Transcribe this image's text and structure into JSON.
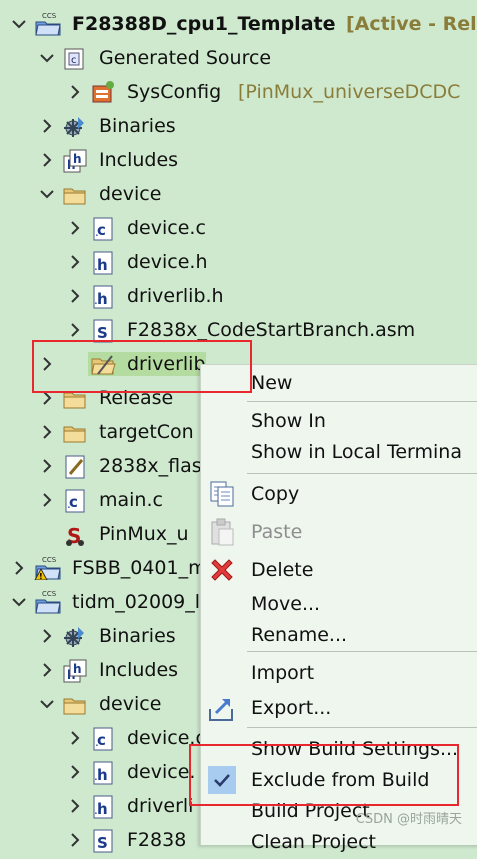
{
  "tree": {
    "rows": [
      {
        "label": "F28388D_cpu1_Template",
        "decoration": "[Active - Rele",
        "icon": "ccs-project-icon",
        "expanded": true,
        "bold": true
      },
      {
        "label": "Generated Source",
        "icon": "folder-source-icon",
        "expanded": true
      },
      {
        "label": "SysConfig",
        "decoration": "[PinMux_universeDCDC",
        "icon": "sysconfig-icon",
        "expanded": false
      },
      {
        "label": "Binaries",
        "icon": "binaries-icon",
        "expanded": false
      },
      {
        "label": "Includes",
        "icon": "includes-icon",
        "expanded": false
      },
      {
        "label": "device",
        "icon": "folder-icon",
        "expanded": true
      },
      {
        "label": "device.c",
        "icon": "c-file-icon",
        "expanded": false
      },
      {
        "label": "device.h",
        "icon": "h-file-icon",
        "expanded": false
      },
      {
        "label": "driverlib.h",
        "icon": "h-file-icon",
        "expanded": false
      },
      {
        "label": "F2838x_CodeStartBranch.asm",
        "icon": "asm-file-icon",
        "expanded": false
      },
      {
        "label": "driverlib",
        "icon": "folder-excluded-icon",
        "expanded": false,
        "selected": true
      },
      {
        "label": "Release",
        "icon": "folder-icon",
        "expanded": false
      },
      {
        "label": "targetCon",
        "icon": "folder-icon",
        "expanded": false
      },
      {
        "label": "2838x_flas",
        "icon": "linker-file-icon",
        "expanded": false
      },
      {
        "label": "main.c",
        "icon": "c-file-icon",
        "expanded": false
      },
      {
        "label": "PinMux_u",
        "icon": "syscfg-file-icon"
      },
      {
        "label": "FSBB_0401_m",
        "icon": "ccs-project-warning-icon",
        "expanded": false
      },
      {
        "label": "tidm_02009_l",
        "icon": "ccs-project-icon",
        "expanded": true
      },
      {
        "label": "Binaries",
        "icon": "binaries-icon",
        "expanded": false
      },
      {
        "label": "Includes",
        "icon": "includes-icon",
        "expanded": false
      },
      {
        "label": "device",
        "icon": "folder-icon",
        "expanded": true
      },
      {
        "label": "device.c",
        "icon": "c-file-icon",
        "expanded": false
      },
      {
        "label": "device.",
        "icon": "h-file-icon",
        "expanded": false
      },
      {
        "label": "driverli",
        "icon": "h-file-icon",
        "expanded": false
      },
      {
        "label": "F2838",
        "icon": "asm-file-icon",
        "expanded": false
      }
    ]
  },
  "menu": {
    "items": [
      {
        "label": "New",
        "icon": ""
      },
      {
        "label": "Show In",
        "icon": ""
      },
      {
        "label": "Show in Local Termina",
        "icon": ""
      },
      {
        "label": "Copy",
        "icon": "copy-icon"
      },
      {
        "label": "Paste",
        "icon": "paste-icon",
        "disabled": true
      },
      {
        "label": "Delete",
        "icon": "delete-icon"
      },
      {
        "label": "Move...",
        "icon": ""
      },
      {
        "label": "Rename...",
        "icon": ""
      },
      {
        "label": "Import",
        "icon": ""
      },
      {
        "label": "Export...",
        "icon": "export-icon"
      },
      {
        "label": "Show Build Settings...",
        "icon": ""
      },
      {
        "label": "Exclude from Build",
        "icon": "checkmark-icon",
        "checked": true
      },
      {
        "label": "Build Project",
        "icon": ""
      },
      {
        "label": "Clean Project",
        "icon": ""
      }
    ]
  },
  "watermark": "CSDN @时雨晴天",
  "colors": {
    "background": "#cfe9cf",
    "menu_background": "#eef6ee",
    "highlight": "#e8282e",
    "delete_red": "#e23b3b"
  }
}
